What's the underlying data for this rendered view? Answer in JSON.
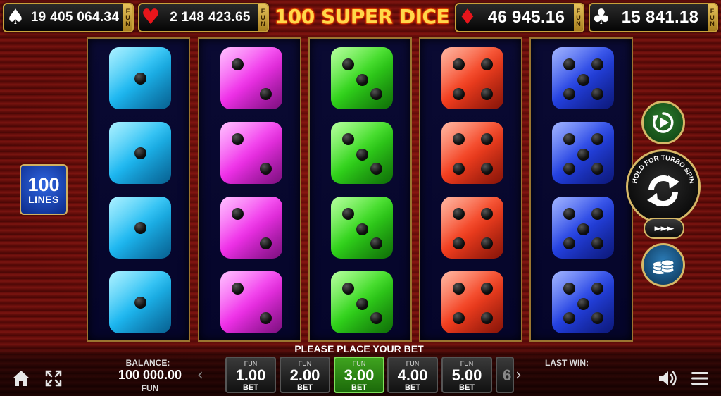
{
  "header": {
    "title": "100 SUPER DICE",
    "jackpots": [
      {
        "suit": "spade",
        "symbol": "♠",
        "amount": "19 405 064.34",
        "currency": "FUN",
        "suit_color": "#ffffff"
      },
      {
        "suit": "heart",
        "symbol": "♥",
        "amount": "2 148 423.65",
        "currency": "FUN",
        "suit_color": "#e8151b"
      },
      {
        "suit": "diamond",
        "symbol": "♦",
        "amount": "46 945.16",
        "currency": "FUN",
        "suit_color": "#e8151b"
      },
      {
        "suit": "club",
        "symbol": "♣",
        "amount": "15 841.18",
        "currency": "FUN",
        "suit_color": "#ffffff"
      }
    ]
  },
  "reels": [
    {
      "color": "cyan",
      "faces": [
        1,
        1,
        1,
        1
      ]
    },
    {
      "color": "magenta",
      "faces": [
        2,
        2,
        2,
        2
      ]
    },
    {
      "color": "green",
      "faces": [
        3,
        3,
        3,
        3
      ]
    },
    {
      "color": "red",
      "faces": [
        4,
        4,
        4,
        4
      ]
    },
    {
      "color": "blue",
      "faces": [
        5,
        5,
        5,
        5
      ]
    }
  ],
  "lines": {
    "count": "100",
    "label": "LINES"
  },
  "controls": {
    "turbo_hint": "HOLD FOR TURBO SPIN",
    "turbo_symbol": "►►►",
    "autoplay_icon": "autoplay-icon",
    "spin_icon": "spin-arrows-icon",
    "bet_menu_icon": "coin-stack-icon"
  },
  "footer": {
    "prompt": "PLEASE PLACE YOUR BET",
    "balance_label": "BALANCE:",
    "balance_value": "100 000.00",
    "balance_currency": "FUN",
    "last_win_label": "LAST WIN:",
    "prev_arrow": "‹",
    "next_arrow": "›",
    "bets": [
      {
        "currency": "FUN",
        "value": "1.00",
        "label": "BET",
        "selected": false
      },
      {
        "currency": "FUN",
        "value": "2.00",
        "label": "BET",
        "selected": false
      },
      {
        "currency": "FUN",
        "value": "3.00",
        "label": "BET",
        "selected": true
      },
      {
        "currency": "FUN",
        "value": "4.00",
        "label": "BET",
        "selected": false
      },
      {
        "currency": "FUN",
        "value": "5.00",
        "label": "BET",
        "selected": false
      }
    ],
    "bet_partial": "6"
  },
  "colors": {
    "accent_gold": "#c9a23a",
    "selected_bet": "#3fa31f",
    "background": "#5a0b08"
  }
}
